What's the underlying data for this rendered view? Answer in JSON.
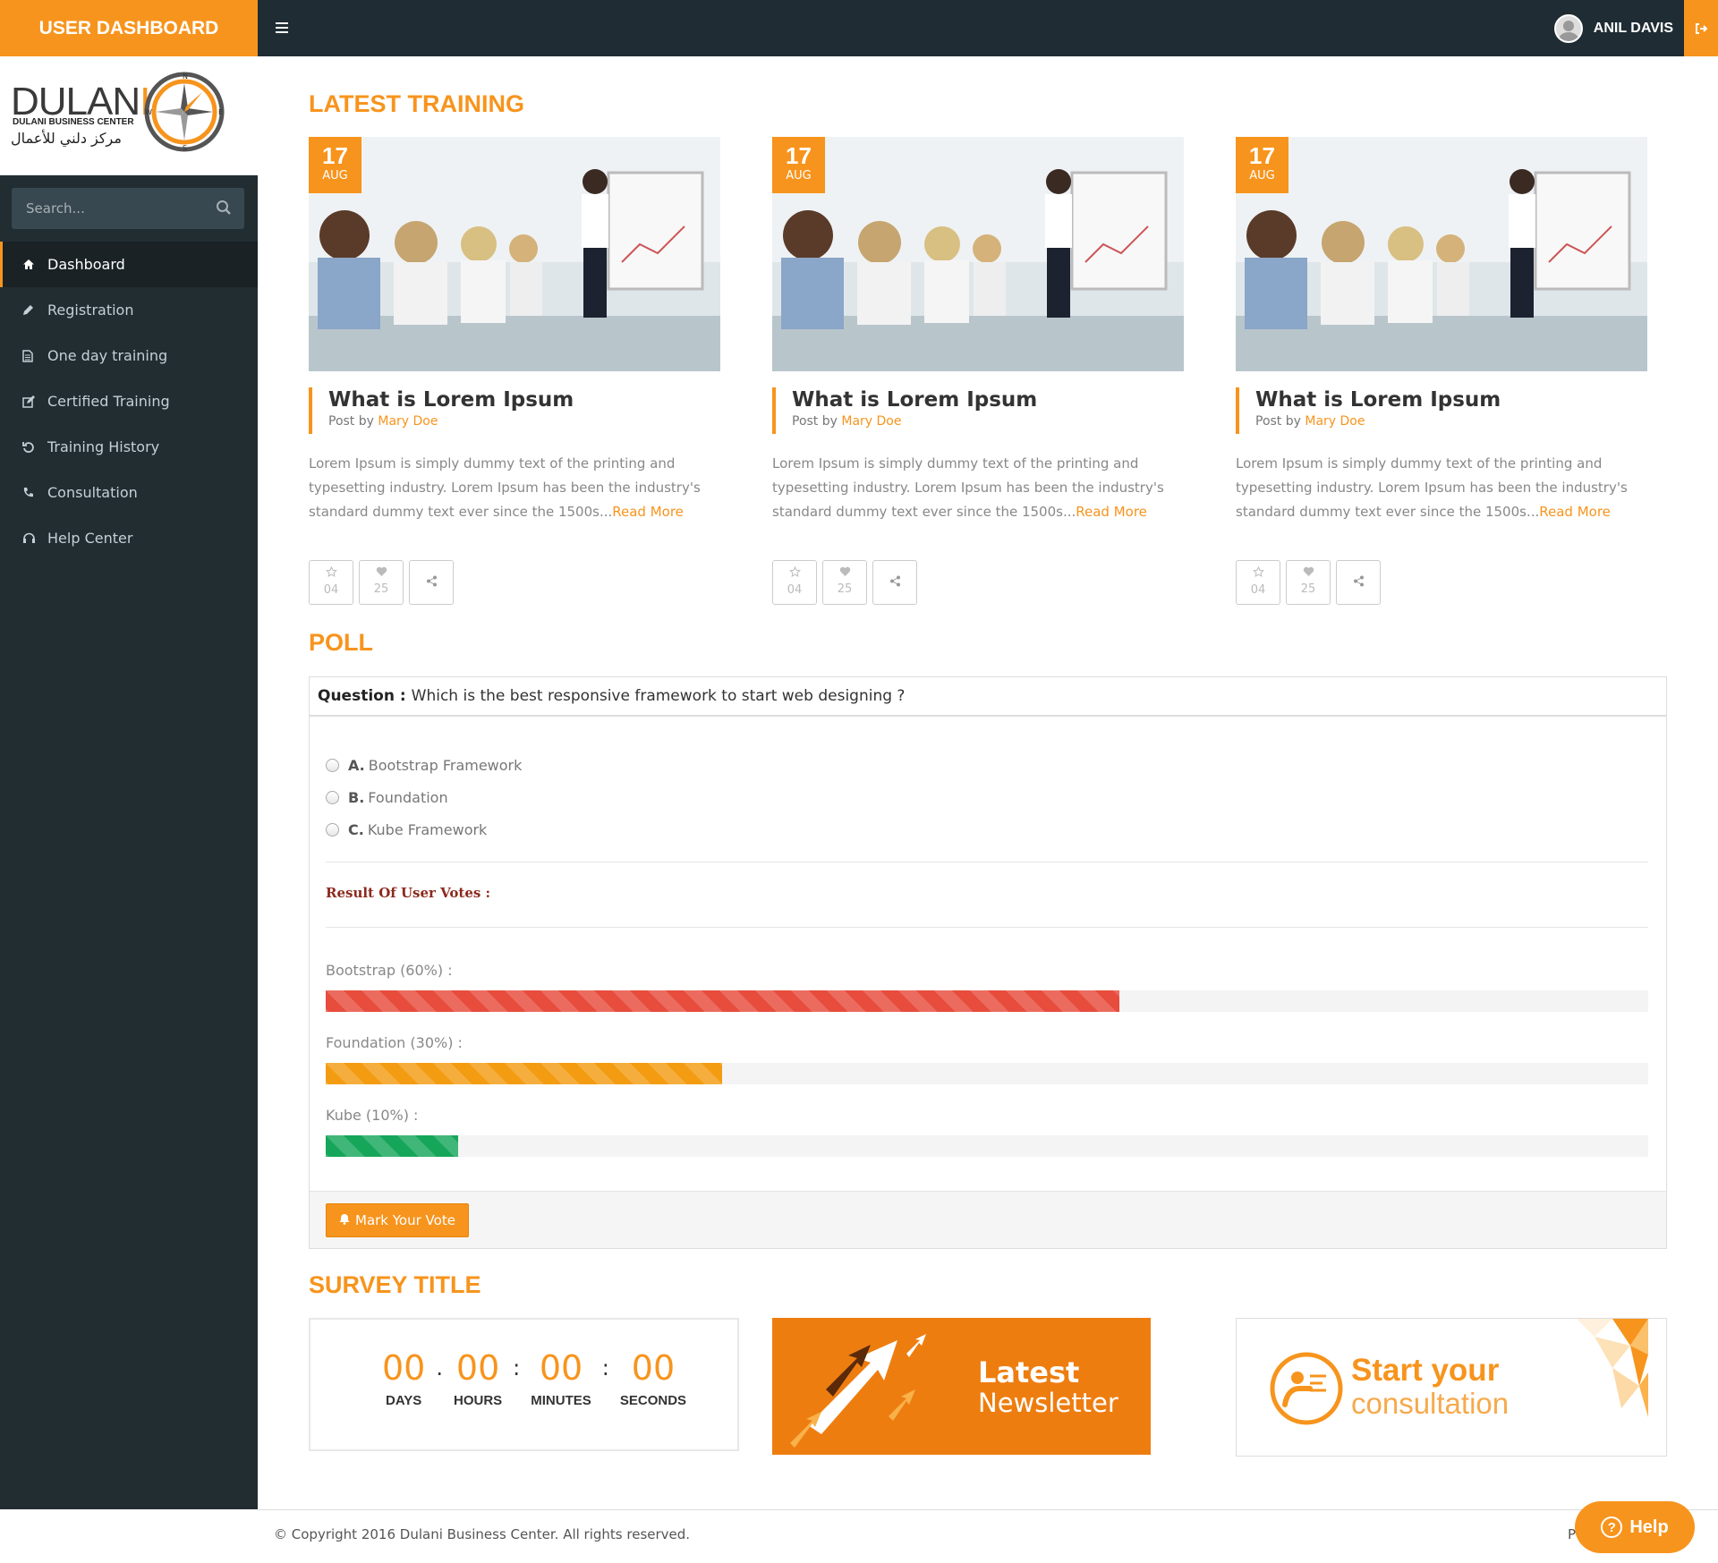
{
  "header": {
    "brand": "USER DASHBOARD",
    "user_name": "ANIL DAVIS"
  },
  "sidebar": {
    "logo": {
      "name": "DULANI",
      "subtitle": "DULANI BUSINESS CENTER",
      "arabic": "مركز دلني للأعمال",
      "compass_letters": [
        "N",
        "E",
        "S",
        "W"
      ]
    },
    "search_placeholder": "Search...",
    "items": [
      {
        "label": "Dashboard",
        "icon": "home-icon"
      },
      {
        "label": "Registration",
        "icon": "pencil-icon"
      },
      {
        "label": "One day training",
        "icon": "file-icon"
      },
      {
        "label": "Certified Training",
        "icon": "edit-icon"
      },
      {
        "label": "Training History",
        "icon": "history-icon"
      },
      {
        "label": "Consultation",
        "icon": "phone-icon"
      },
      {
        "label": "Help Center",
        "icon": "help-icon"
      }
    ]
  },
  "training": {
    "title": "LATEST TRAINING",
    "cards": [
      {
        "day": "17",
        "month": "AUG",
        "title": "What is Lorem Ipsum",
        "post_by": "Post by",
        "author": "Mary Doe",
        "text": "Lorem Ipsum is simply dummy text of the printing and typesetting industry. Lorem Ipsum has been the industry's standard dummy text ever since the 1500s...",
        "read_more": "Read More",
        "stars": "04",
        "likes": "25"
      },
      {
        "day": "17",
        "month": "AUG",
        "title": "What is Lorem Ipsum",
        "post_by": "Post by",
        "author": "Mary Doe",
        "text": "Lorem Ipsum is simply dummy text of the printing and typesetting industry. Lorem Ipsum has been the industry's standard dummy text ever since the 1500s...",
        "read_more": "Read More",
        "stars": "04",
        "likes": "25"
      },
      {
        "day": "17",
        "month": "AUG",
        "title": "What is Lorem Ipsum",
        "post_by": "Post by",
        "author": "Mary Doe",
        "text": "Lorem Ipsum is simply dummy text of the printing and typesetting industry. Lorem Ipsum has been the industry's standard dummy text ever since the 1500s...",
        "read_more": "Read More",
        "stars": "04",
        "likes": "25"
      }
    ]
  },
  "poll": {
    "title": "POLL",
    "question_label": "Question :",
    "question": "Which is the best responsive framework to start web designing ?",
    "options": [
      {
        "key": "A.",
        "label": "Bootstrap Framework"
      },
      {
        "key": "B.",
        "label": "Foundation"
      },
      {
        "key": "C.",
        "label": "Kube Framework"
      }
    ],
    "result_label": "Result Of User Votes :",
    "results": [
      {
        "label": "Bootstrap (60%) :",
        "percent": 60,
        "color": "#e74c3c"
      },
      {
        "label": "Foundation (30%) :",
        "percent": 30,
        "color": "#f39c12"
      },
      {
        "label": "Kube (10%) :",
        "percent": 10,
        "color": "#16a65a"
      }
    ],
    "vote_button": "Mark Your Vote"
  },
  "survey": {
    "title": "SURVEY TITLE",
    "countdown": {
      "days": "00",
      "hours": "00",
      "minutes": "00",
      "seconds": "00",
      "days_label": "DAYS",
      "hours_label": "HOURS",
      "minutes_label": "MINUTES",
      "seconds_label": "SECONDS"
    },
    "newsletter": {
      "line1": "Latest",
      "line2": "Newsletter"
    },
    "consultation": {
      "line1": "Start your",
      "line2": "consultation"
    }
  },
  "footer": {
    "copyright": "© Copyright 2016 Dulani Business Center. All rights reserved.",
    "right_text": "P"
  },
  "help_button": "Help",
  "colors": {
    "accent": "#f7941d",
    "sidebar": "#222d32",
    "topbar": "#1f2c33"
  }
}
